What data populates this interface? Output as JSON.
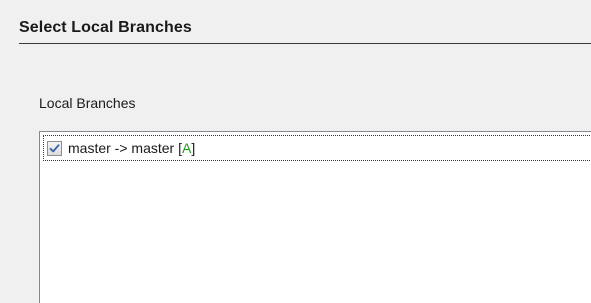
{
  "header": {
    "title": "Select Local Branches"
  },
  "group": {
    "label": "Local Branches"
  },
  "branches": [
    {
      "label": "master -> master",
      "open_bracket": "[",
      "status": "A",
      "close_bracket": "]",
      "checked": true
    }
  ],
  "colors": {
    "status_added": "#1aa31a",
    "check_mark": "#3b5fa8"
  },
  "icons": {
    "check": "check-icon"
  }
}
